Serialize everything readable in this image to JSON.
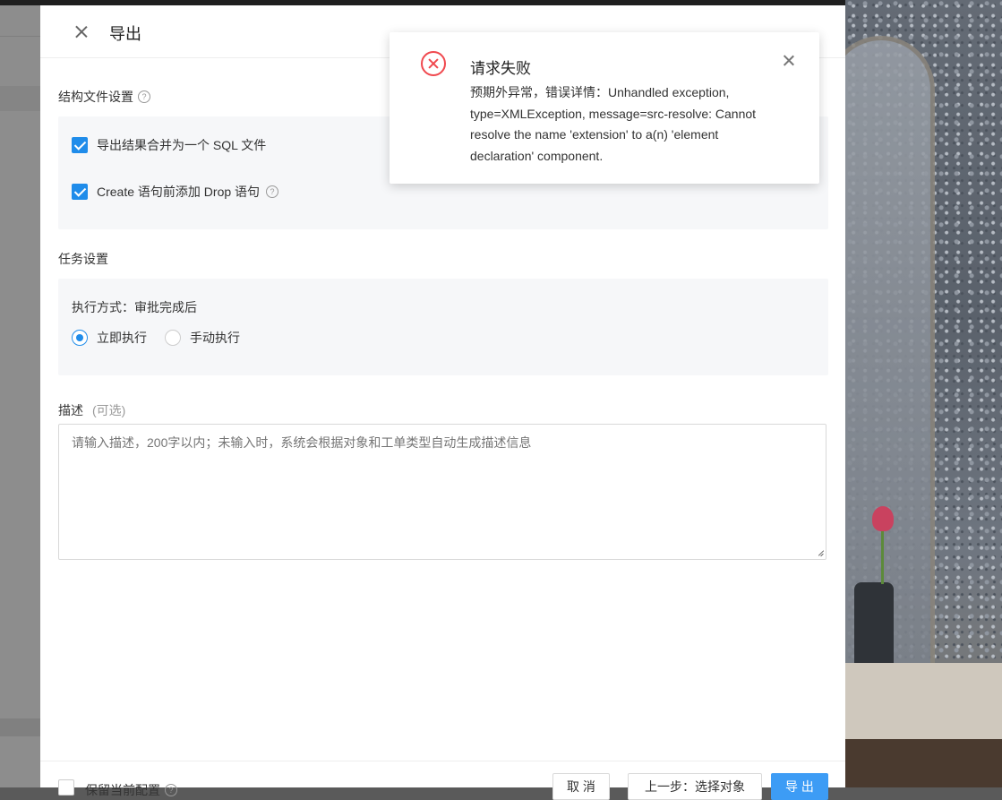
{
  "drawer": {
    "title": "导出",
    "structure_section": {
      "title": "结构文件设置",
      "merge_sql_label": "导出结果合并为一个 SQL 文件",
      "add_drop_label": "Create 语句前添加 Drop 语句"
    },
    "task_section": {
      "title": "任务设置",
      "exec_mode_label": "执行方式：审批完成后",
      "options": [
        "立即执行",
        "手动执行"
      ],
      "selected": "立即执行"
    },
    "description": {
      "label": "描述",
      "optional": "(可选)",
      "placeholder": "请输入描述，200字以内；未输入时，系统会根据对象和工单类型自动生成描述信息",
      "value": ""
    },
    "footer": {
      "keep_config_label": "保留当前配置",
      "cancel": "取 消",
      "prev": "上一步：选择对象",
      "export": "导 出"
    }
  },
  "notification": {
    "title": "请求失败",
    "message": "预期外异常，错误详情：Unhandled exception, type=XMLException, message=src-resolve: Cannot resolve the name 'extension' to a(n) 'element declaration' component.",
    "icon": "error-circle-icon",
    "color": "#f0484e"
  },
  "colors": {
    "accent": "#1f8cea",
    "primary_button": "#3d9cf5"
  }
}
